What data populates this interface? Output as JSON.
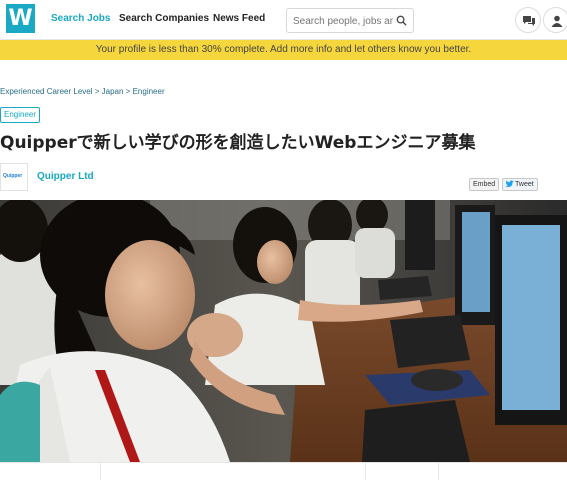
{
  "header": {
    "logo_letter": "W",
    "nav": {
      "search_jobs": "Search Jobs",
      "search_companies": "Search Companies",
      "news_feed": "News Feed"
    },
    "search": {
      "placeholder": "Search people, jobs and"
    }
  },
  "banner": {
    "text": "Your profile is less than 30% complete. Add more info and let others know you better."
  },
  "breadcrumb": {
    "items": [
      "Experienced Career Level",
      "Japan",
      "Engineer"
    ],
    "separator": ">"
  },
  "job": {
    "category_tag": "Engineer",
    "title": "Quipperで新しい学びの形を創造したいWebエンジニア募集"
  },
  "company": {
    "logo_text": "Quipper",
    "name": "Quipper Ltd"
  },
  "share": {
    "embed_label": "Embed",
    "tweet_label": "Tweet"
  },
  "colors": {
    "accent": "#1aa9c4",
    "banner": "#f5d63d",
    "link": "#2a6d86"
  }
}
